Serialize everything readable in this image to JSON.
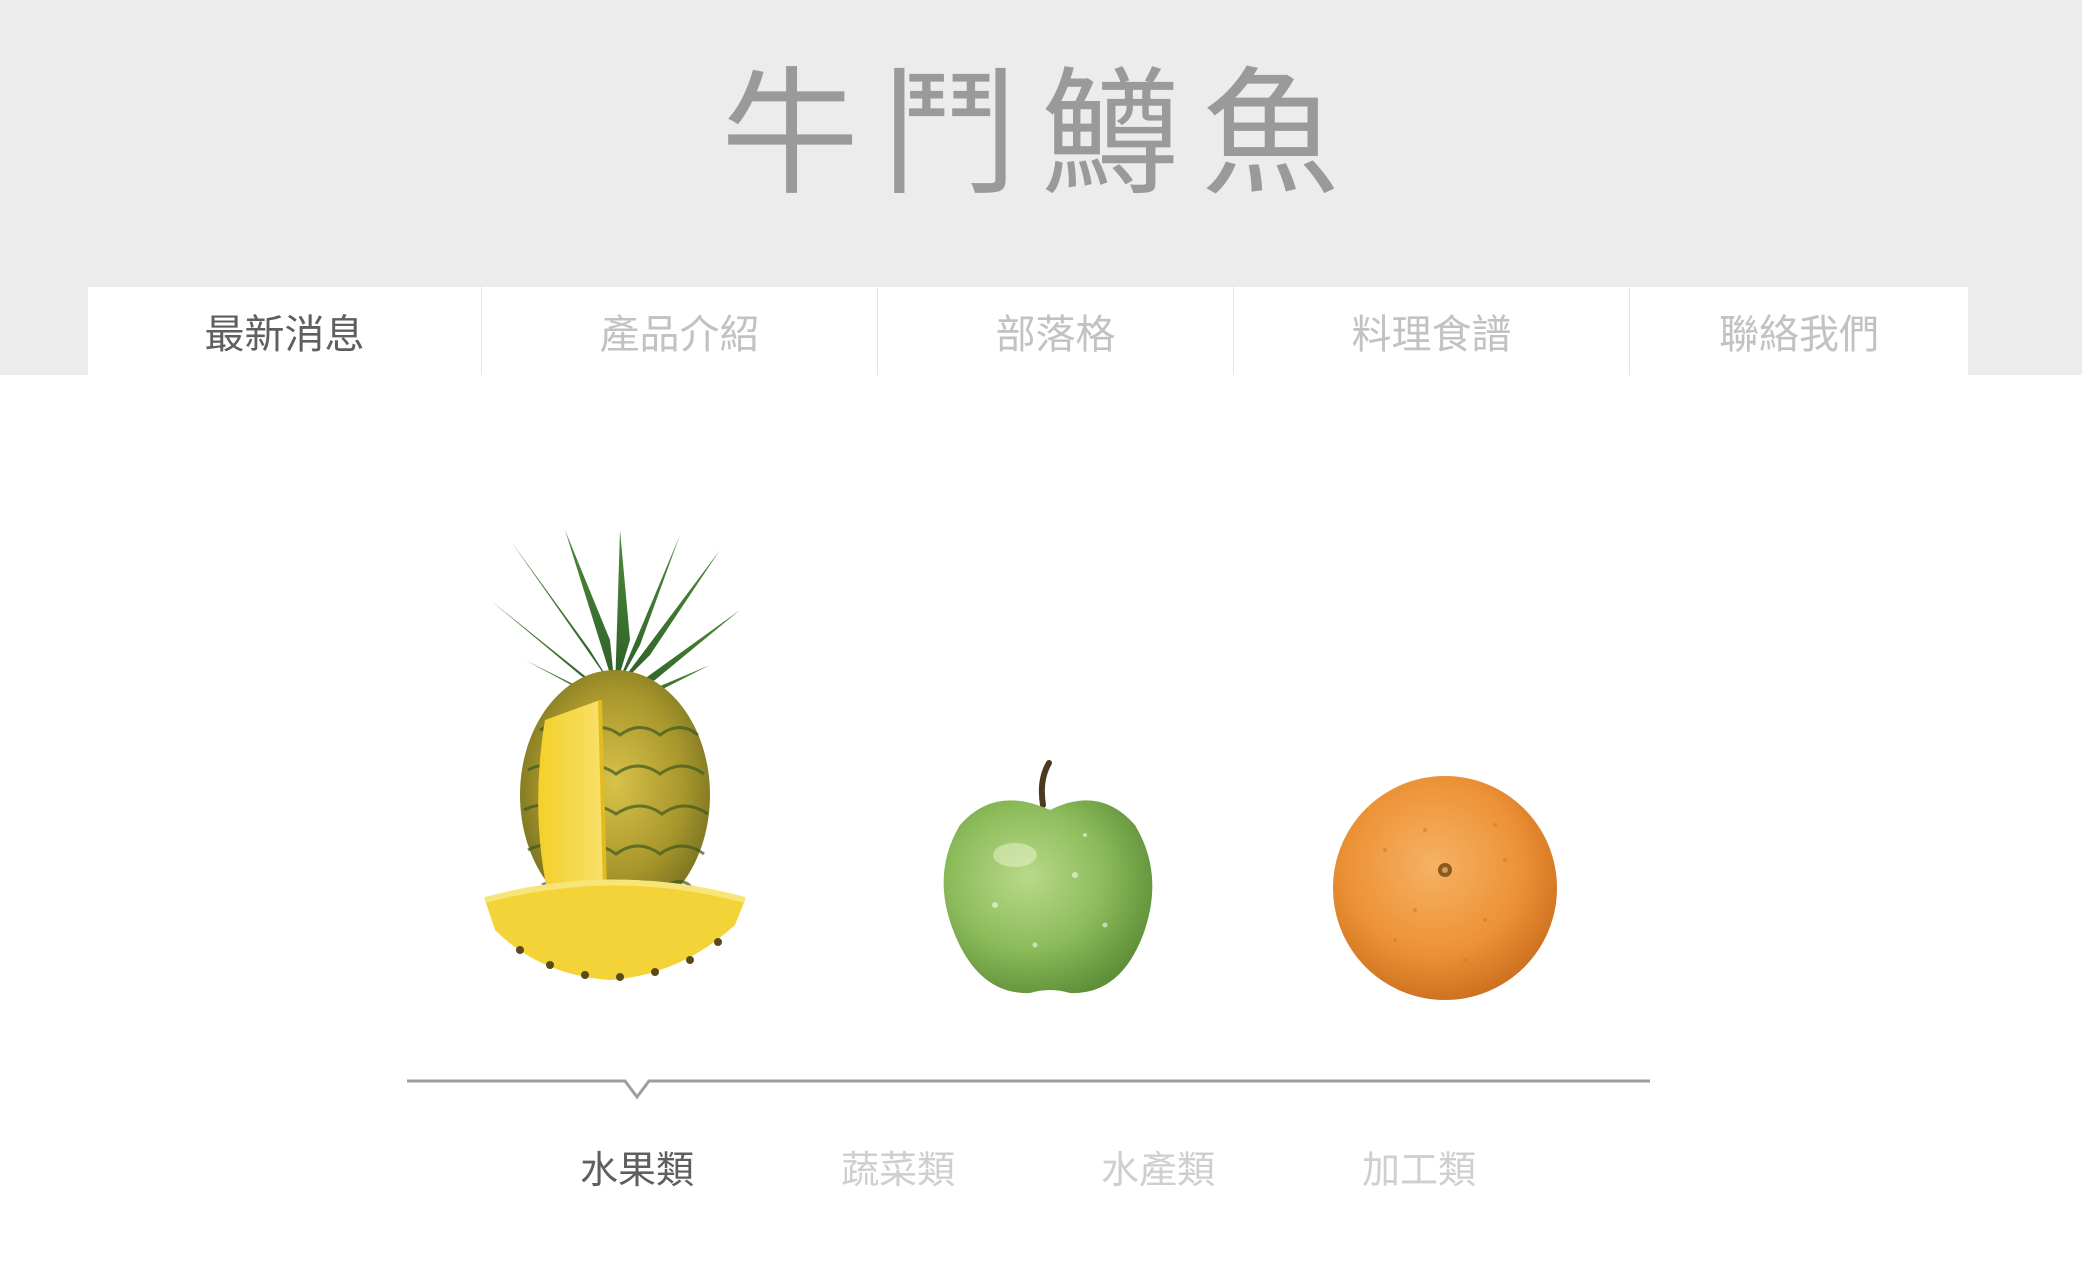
{
  "header": {
    "site_title": "牛鬥鱒魚"
  },
  "nav": {
    "items": [
      {
        "label": "最新消息",
        "active": true
      },
      {
        "label": "產品介紹",
        "active": false
      },
      {
        "label": "部落格",
        "active": false
      },
      {
        "label": "料理食譜",
        "active": false
      },
      {
        "label": "聯絡我們",
        "active": false
      }
    ]
  },
  "products": {
    "items": [
      {
        "icon": "pineapple-image"
      },
      {
        "icon": "green-apple-image"
      },
      {
        "icon": "orange-image"
      }
    ]
  },
  "categories": {
    "selected": "水果類",
    "items": [
      {
        "label": "水果類",
        "active": true
      },
      {
        "label": "蔬菜類",
        "active": false
      },
      {
        "label": "水產類",
        "active": false
      },
      {
        "label": "加工類",
        "active": false
      }
    ]
  },
  "colors": {
    "header_bg": "#ececec",
    "title_gray": "#9a9a9a",
    "active_text": "#5f5f5f",
    "inactive_text": "#c2c2c2",
    "timeline_line": "#9e9e9e"
  }
}
